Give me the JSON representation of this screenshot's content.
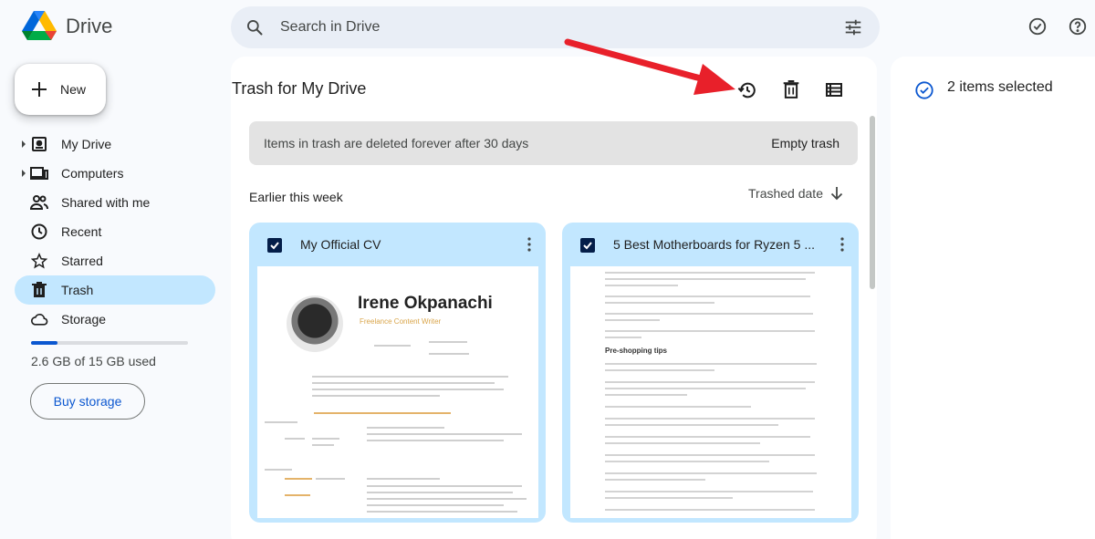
{
  "app": {
    "name": "Drive",
    "search_placeholder": "Search in Drive"
  },
  "sidebar": {
    "new_label": "New",
    "items": [
      {
        "label": "My Drive",
        "icon": "my-drive-icon",
        "expandable": true
      },
      {
        "label": "Computers",
        "icon": "computers-icon",
        "expandable": true
      },
      {
        "label": "Shared with me",
        "icon": "shared-icon",
        "expandable": false
      },
      {
        "label": "Recent",
        "icon": "clock-icon",
        "expandable": false
      },
      {
        "label": "Starred",
        "icon": "star-icon",
        "expandable": false
      },
      {
        "label": "Trash",
        "icon": "trash-icon",
        "expandable": false,
        "active": true
      },
      {
        "label": "Storage",
        "icon": "cloud-icon",
        "expandable": false
      }
    ],
    "storage_used_fraction": 0.17,
    "storage_text": "2.6 GB of 15 GB used",
    "buy_storage_label": "Buy storage"
  },
  "main": {
    "title": "Trash for My Drive",
    "banner_text": "Items in trash are deleted forever after 30 days",
    "empty_trash_label": "Empty trash",
    "section_label": "Earlier this week",
    "sort_label": "Trashed date",
    "files": [
      {
        "title": "My Official CV",
        "checked": true
      },
      {
        "title": "5 Best Motherboards for Ryzen 5 ...",
        "checked": true
      }
    ],
    "cv_preview": {
      "name": "Irene Okpanachi",
      "subtitle": "Freelance Content Writer"
    },
    "doc_preview": {
      "heading": "Pre-shopping tips"
    }
  },
  "details": {
    "selected_text": "2 items selected"
  },
  "colors": {
    "accent": "#0b57d0",
    "selected_bg": "#c2e7ff",
    "annotation_arrow": "#e8202a"
  }
}
